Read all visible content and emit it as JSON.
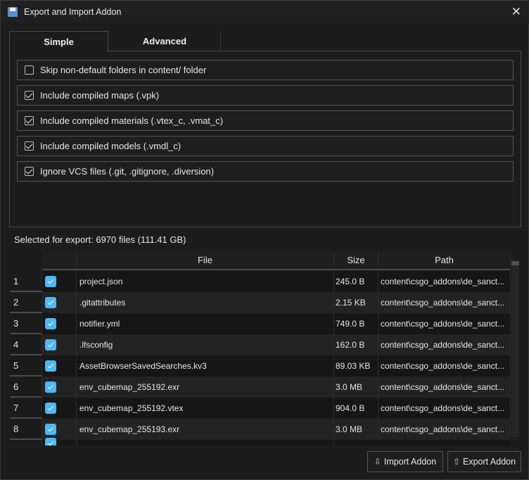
{
  "window": {
    "title": "Export and Import Addon",
    "icon": "floppy-disk-icon"
  },
  "tabs": [
    {
      "label": "Simple",
      "active": true
    },
    {
      "label": "Advanced",
      "active": false
    }
  ],
  "options": [
    {
      "label": "Skip non-default folders in content/ folder",
      "checked": false
    },
    {
      "label": "Include compiled maps (.vpk)",
      "checked": true
    },
    {
      "label": "Include compiled materials (.vtex_c, .vmat_c)",
      "checked": true
    },
    {
      "label": "Include compiled models (.vmdl_c)",
      "checked": true
    },
    {
      "label": "Ignore VCS files (.git, .gitignore, .diversion)",
      "checked": true
    }
  ],
  "summary": "Selected for export: 6970 files (111.41 GB)",
  "table": {
    "columns": [
      "",
      "File",
      "Size",
      "Path"
    ],
    "rows": [
      {
        "n": "1",
        "file": "project.json",
        "size": "245.0 B",
        "path": "content\\csgo_addons\\de_sanct..."
      },
      {
        "n": "2",
        "file": ".gitattributes",
        "size": "2.15 KB",
        "path": "content\\csgo_addons\\de_sanct..."
      },
      {
        "n": "3",
        "file": "notifier.yml",
        "size": "749.0 B",
        "path": "content\\csgo_addons\\de_sanct..."
      },
      {
        "n": "4",
        "file": ".lfsconfig",
        "size": "162.0 B",
        "path": "content\\csgo_addons\\de_sanct..."
      },
      {
        "n": "5",
        "file": "AssetBrowserSavedSearches.kv3",
        "size": "89.03 KB",
        "path": "content\\csgo_addons\\de_sanct..."
      },
      {
        "n": "6",
        "file": "env_cubemap_255192.exr",
        "size": "3.0 MB",
        "path": "content\\csgo_addons\\de_sanct..."
      },
      {
        "n": "7",
        "file": "env_cubemap_255192.vtex",
        "size": "904.0 B",
        "path": "content\\csgo_addons\\de_sanct..."
      },
      {
        "n": "8",
        "file": "env_cubemap_255193.exr",
        "size": "3.0 MB",
        "path": "content\\csgo_addons\\de_sanct..."
      }
    ]
  },
  "buttons": {
    "import": "Import Addon",
    "export": "Export Addon"
  },
  "colors": {
    "accent": "#4db8f5",
    "row_even": "#161616",
    "row_odd": "#232323"
  }
}
